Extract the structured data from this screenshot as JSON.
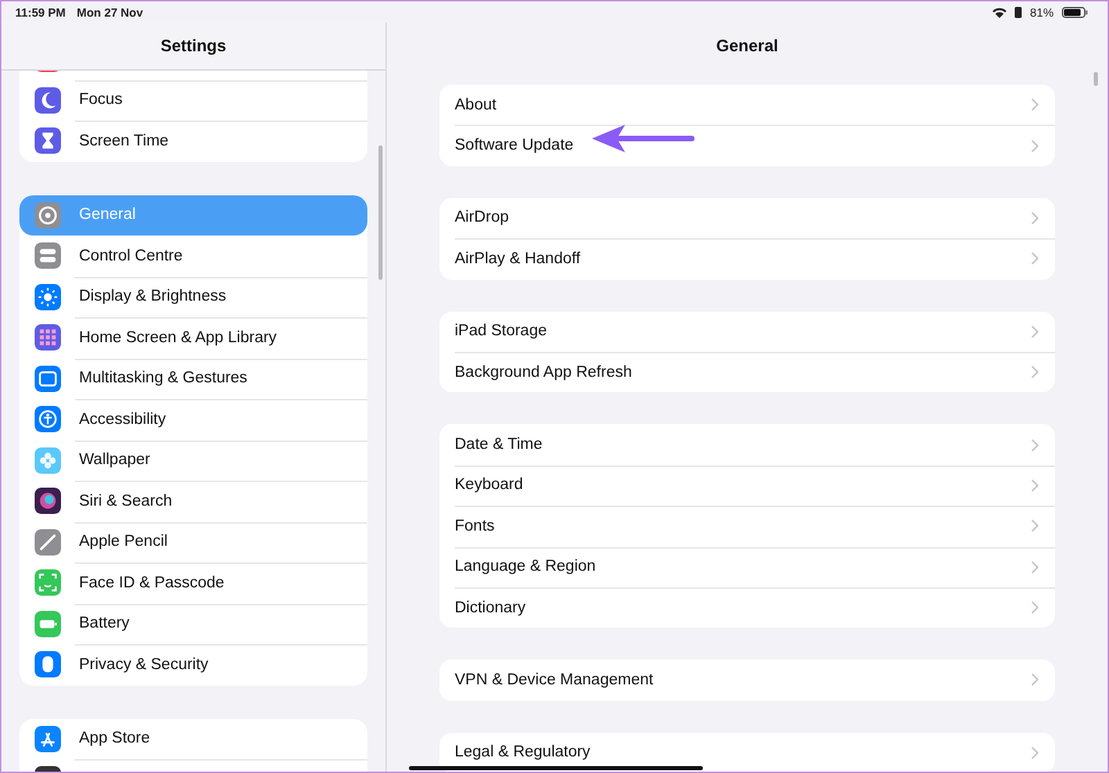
{
  "status_bar": {
    "time": "11:59 PM",
    "date": "Mon 27 Nov",
    "battery_text": "81%"
  },
  "sidebar": {
    "title": "Settings",
    "groups": [
      {
        "items": [
          {
            "kind": "partial",
            "color": "#ff3b5c"
          },
          {
            "kind": "row",
            "label": "Focus",
            "color": "#5e5ce6",
            "selected": false
          },
          {
            "kind": "row",
            "label": "Screen Time",
            "color": "#5e5ce6",
            "selected": false
          }
        ]
      },
      {
        "items": [
          {
            "kind": "row",
            "label": "General",
            "color": "#8e8e93",
            "selected": true
          },
          {
            "kind": "row",
            "label": "Control Centre",
            "color": "#8e8e93",
            "selected": false
          },
          {
            "kind": "row",
            "label": "Display & Brightness",
            "color": "#007aff",
            "selected": false
          },
          {
            "kind": "row",
            "label": "Home Screen & App Library",
            "color": "#5e5ce6",
            "selected": false
          },
          {
            "kind": "row",
            "label": "Multitasking & Gestures",
            "color": "#007aff",
            "selected": false
          },
          {
            "kind": "row",
            "label": "Accessibility",
            "color": "#007aff",
            "selected": false
          },
          {
            "kind": "row",
            "label": "Wallpaper",
            "color": "#5ac8fa",
            "selected": false
          },
          {
            "kind": "row",
            "label": "Siri & Search",
            "color": "#3a1f4f",
            "selected": false
          },
          {
            "kind": "row",
            "label": "Apple Pencil",
            "color": "#8e8e93",
            "selected": false
          },
          {
            "kind": "row",
            "label": "Face ID & Passcode",
            "color": "#34c759",
            "selected": false
          },
          {
            "kind": "row",
            "label": "Battery",
            "color": "#34c759",
            "selected": false
          },
          {
            "kind": "row",
            "label": "Privacy & Security",
            "color": "#007aff",
            "selected": false
          }
        ]
      },
      {
        "items": [
          {
            "kind": "row",
            "label": "App Store",
            "color": "#0a84ff",
            "selected": false
          },
          {
            "kind": "partial",
            "color": "#333336"
          }
        ]
      }
    ]
  },
  "detail": {
    "title": "General",
    "groups": [
      [
        "About",
        "Software Update"
      ],
      [
        "AirDrop",
        "AirPlay & Handoff"
      ],
      [
        "iPad Storage",
        "Background App Refresh"
      ],
      [
        "Date & Time",
        "Keyboard",
        "Fonts",
        "Language & Region",
        "Dictionary"
      ],
      [
        "VPN & Device Management"
      ],
      [
        "Legal & Regulatory"
      ]
    ]
  }
}
